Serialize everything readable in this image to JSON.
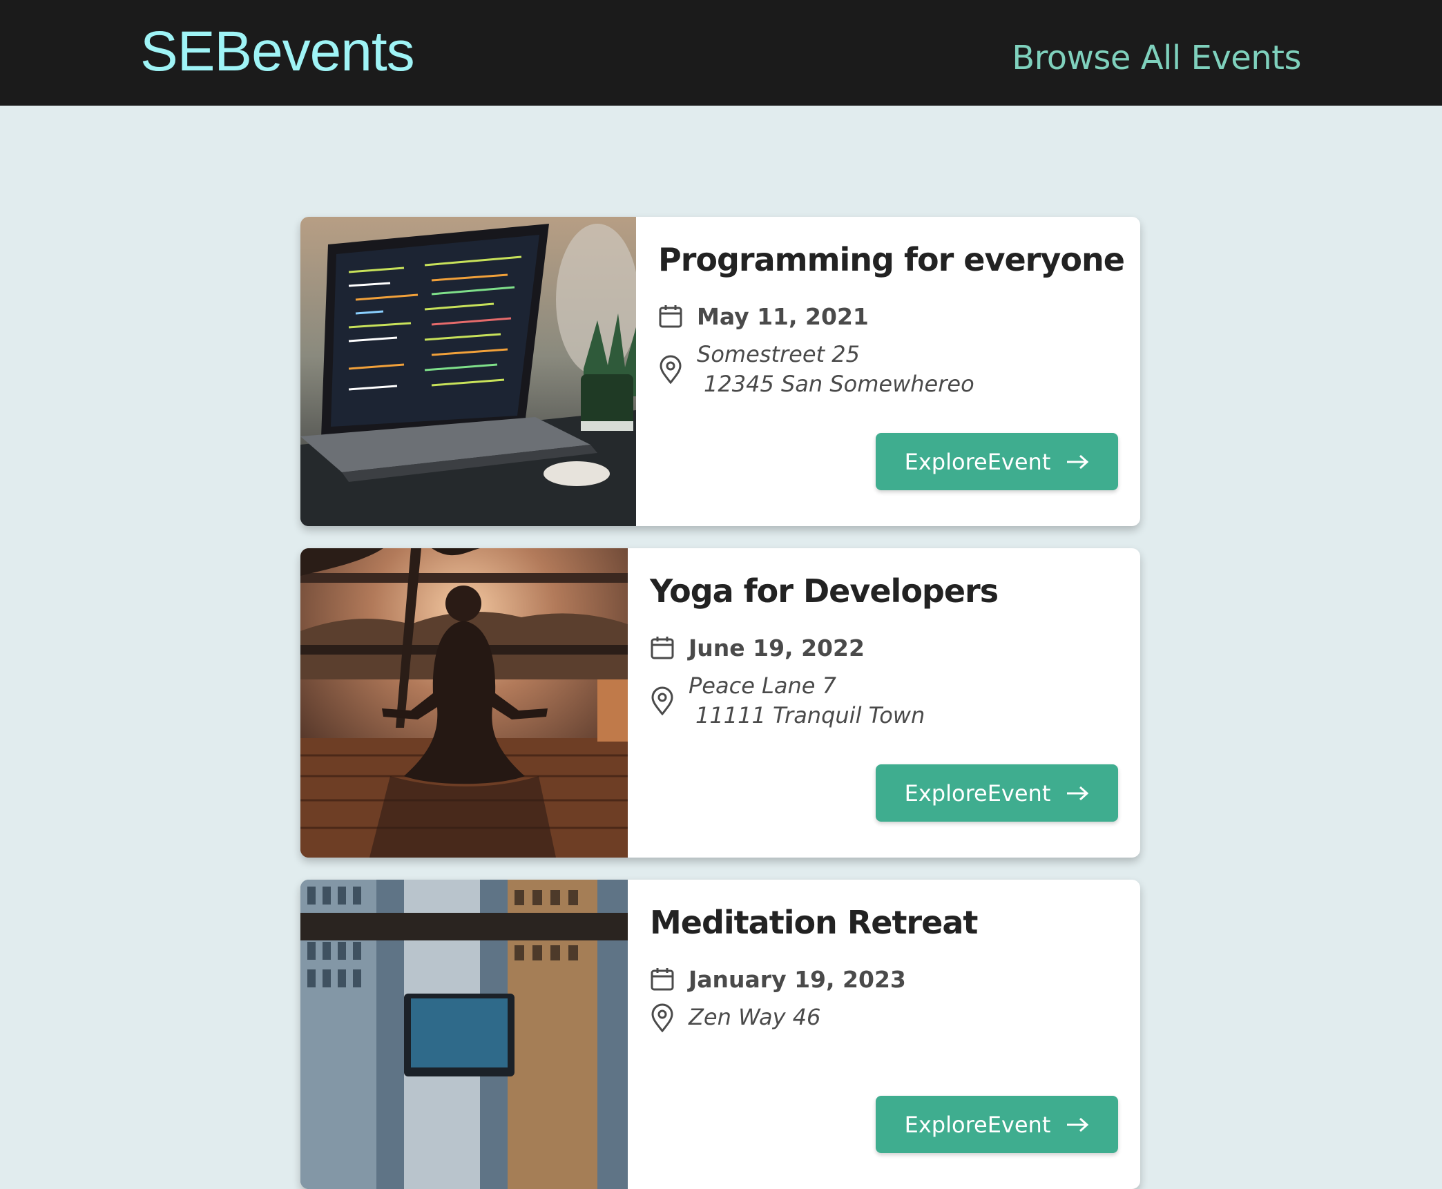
{
  "header": {
    "logo": "SEBevents",
    "nav_link": "Browse All Events"
  },
  "events": [
    {
      "title": "Programming for everyone",
      "date": "May 11, 2021",
      "address_line1": "Somestreet 25",
      "address_line2": "12345 San Somewhereo",
      "button_label": "ExploreEvent",
      "image": "laptop-with-code-on-table"
    },
    {
      "title": "Yoga for Developers",
      "date": "June 19, 2022",
      "address_line1": "Peace Lane 7",
      "address_line2": "11111 Tranquil Town",
      "button_label": "ExploreEvent",
      "image": "person-meditating-at-sunset"
    },
    {
      "title": "Meditation Retreat",
      "date": "January 19, 2023",
      "address_line1": "Zen Way 46",
      "address_line2": "",
      "button_label": "ExploreEvent",
      "image": "laptop-by-window-city-view"
    }
  ],
  "colors": {
    "header_bg": "#1b1b1b",
    "logo": "#9ff4f6",
    "nav_link": "#7fd1bd",
    "page_bg": "#e1ecee",
    "button_bg": "#3fad8f"
  }
}
